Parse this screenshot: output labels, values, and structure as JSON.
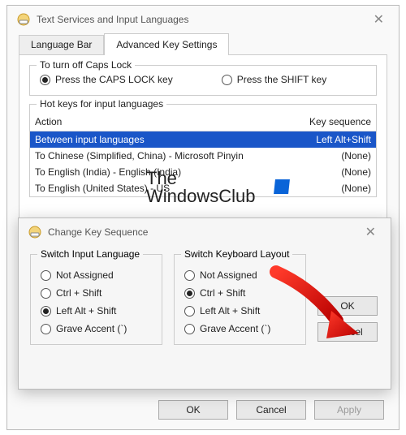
{
  "mainWindow": {
    "title": "Text Services and Input Languages",
    "tabs": [
      "Language Bar",
      "Advanced Key Settings"
    ],
    "activeTab": 1,
    "capsLock": {
      "legend": "To turn off Caps Lock",
      "opt1": "Press the CAPS LOCK key",
      "opt2": "Press the SHIFT key"
    },
    "hotkeys": {
      "legend": "Hot keys for input languages",
      "colAction": "Action",
      "colKeyseq": "Key sequence",
      "rows": [
        {
          "action": "Between input languages",
          "keyseq": "Left Alt+Shift",
          "selected": true
        },
        {
          "action": "To Chinese (Simplified, China) - Microsoft Pinyin",
          "keyseq": "(None)",
          "selected": false
        },
        {
          "action": "To English (India) - English (India)",
          "keyseq": "(None)",
          "selected": false
        },
        {
          "action": "To English (United States) - US",
          "keyseq": "(None)",
          "selected": false
        }
      ]
    },
    "buttons": {
      "ok": "OK",
      "cancel": "Cancel",
      "apply": "Apply"
    }
  },
  "subWindow": {
    "title": "Change Key Sequence",
    "left": {
      "legend": "Switch Input Language",
      "opts": [
        "Not Assigned",
        "Ctrl + Shift",
        "Left Alt + Shift",
        "Grave Accent (`)"
      ],
      "checked": 2
    },
    "right": {
      "legend": "Switch Keyboard Layout",
      "opts": [
        "Not Assigned",
        "Ctrl + Shift",
        "Left Alt + Shift",
        "Grave Accent (`)"
      ],
      "checked": 1
    },
    "buttons": {
      "ok": "OK",
      "cancel": "Cancel"
    }
  },
  "watermark": {
    "line1": "The",
    "line2": "WindowsClub"
  }
}
